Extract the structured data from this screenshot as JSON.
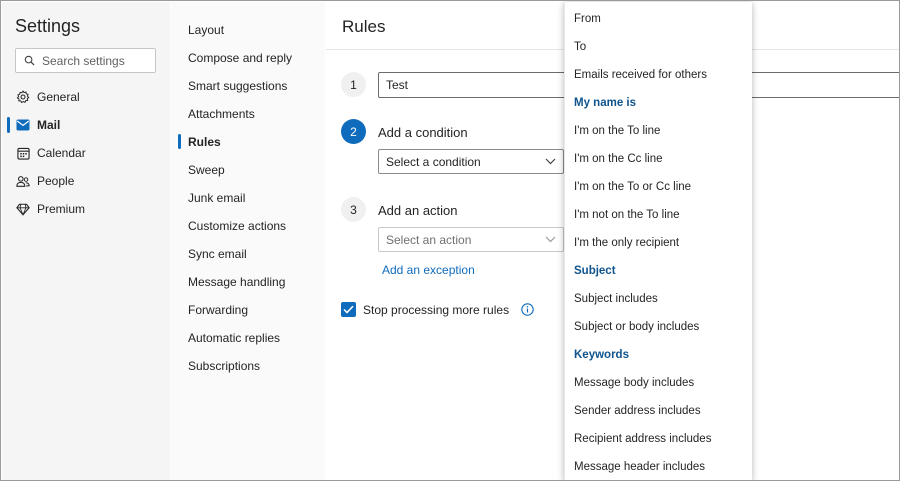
{
  "settings": {
    "title": "Settings",
    "search_placeholder": "Search settings"
  },
  "nav": {
    "items": [
      {
        "label": "General",
        "icon": "gear-icon"
      },
      {
        "label": "Mail",
        "icon": "mail-icon",
        "active": true
      },
      {
        "label": "Calendar",
        "icon": "calendar-icon"
      },
      {
        "label": "People",
        "icon": "people-icon"
      },
      {
        "label": "Premium",
        "icon": "diamond-icon"
      }
    ]
  },
  "mail_menu": {
    "items": [
      "Layout",
      "Compose and reply",
      "Smart suggestions",
      "Attachments",
      "Rules",
      "Sweep",
      "Junk email",
      "Customize actions",
      "Sync email",
      "Message handling",
      "Forwarding",
      "Automatic replies",
      "Subscriptions"
    ],
    "active": "Rules"
  },
  "rules": {
    "title": "Rules",
    "step1_number": "1",
    "rule_name": "Test",
    "step2_number": "2",
    "step2_label": "Add a condition",
    "condition_placeholder": "Select a condition",
    "step3_number": "3",
    "step3_label": "Add an action",
    "action_placeholder": "Select an action",
    "exception_link": "Add an exception",
    "stop_processing_label": "Stop processing more rules",
    "stop_processing_checked": true
  },
  "dropdown": {
    "items": [
      {
        "label": "From",
        "type": "option"
      },
      {
        "label": "To",
        "type": "option"
      },
      {
        "label": "Emails received for others",
        "type": "option"
      },
      {
        "label": "My name is",
        "type": "header"
      },
      {
        "label": "I'm on the To line",
        "type": "option"
      },
      {
        "label": "I'm on the Cc line",
        "type": "option"
      },
      {
        "label": "I'm on the To or Cc line",
        "type": "option"
      },
      {
        "label": "I'm not on the To line",
        "type": "option"
      },
      {
        "label": "I'm the only recipient",
        "type": "option"
      },
      {
        "label": "Subject",
        "type": "header"
      },
      {
        "label": "Subject includes",
        "type": "option"
      },
      {
        "label": "Subject or body includes",
        "type": "option"
      },
      {
        "label": "Keywords",
        "type": "header"
      },
      {
        "label": "Message body includes",
        "type": "option"
      },
      {
        "label": "Sender address includes",
        "type": "option"
      },
      {
        "label": "Recipient address includes",
        "type": "option"
      },
      {
        "label": "Message header includes",
        "type": "option"
      }
    ]
  },
  "colors": {
    "accent": "#0f6cbd",
    "header_text": "#0f548c"
  }
}
